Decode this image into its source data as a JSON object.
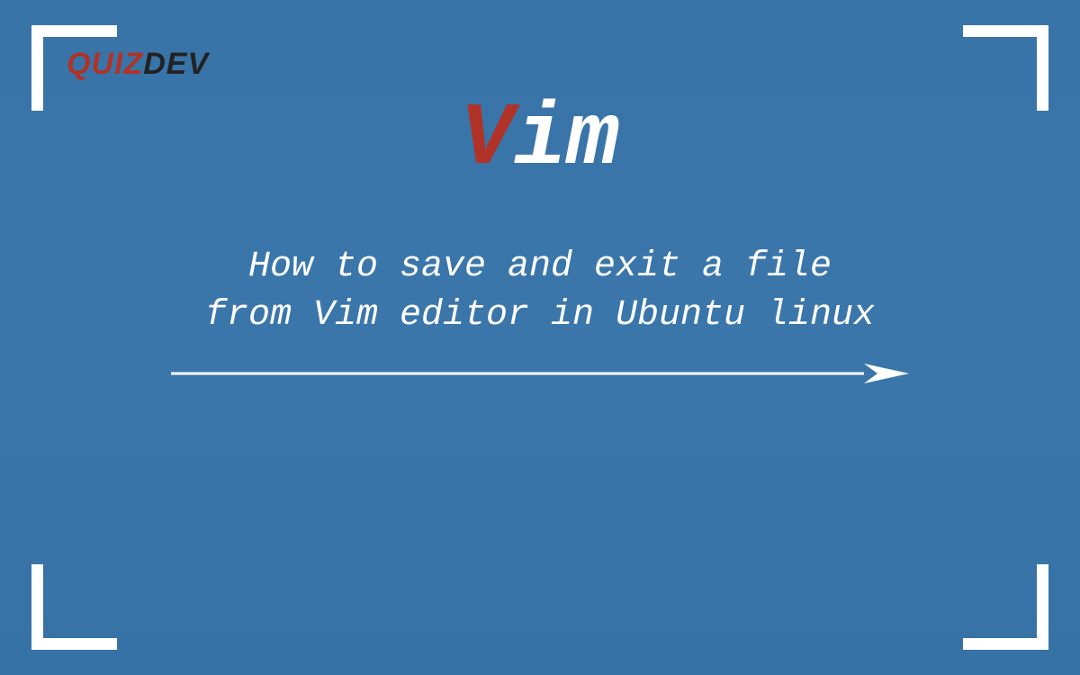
{
  "logo": {
    "part1": "QUIZ",
    "part2": "DEV"
  },
  "heading": {
    "first_letter": "V",
    "rest": "im"
  },
  "subtitle": {
    "line1": "How to save and exit a file",
    "line2": "from Vim editor in Ubuntu linux"
  },
  "colors": {
    "background": "#3a76aa",
    "accent_red": "#b13226",
    "accent_dark": "#222222",
    "white": "#ffffff"
  }
}
